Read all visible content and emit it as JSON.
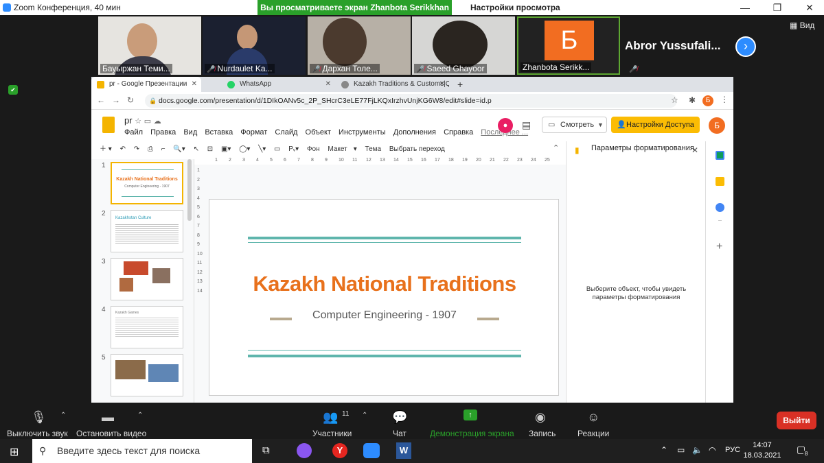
{
  "zoom": {
    "title": "Zoom Конференция, 40 мин",
    "banner": "Вы просматриваете экран Zhanbota Serikkhan",
    "view_options": "Настройки просмотра",
    "view_label": "Вид",
    "participants": [
      {
        "name": "Бауыржан Теми...",
        "muted": false
      },
      {
        "name": "Nurdaulet Ka...",
        "muted": true
      },
      {
        "name": "Дархан Толе...",
        "muted": true
      },
      {
        "name": "Saeed Ghayoor",
        "muted": true
      },
      {
        "name": "Zhanbota Serikk...",
        "muted": false,
        "avatar_letter": "Б",
        "avatar_color": "#f26d21"
      },
      {
        "name": "Abror Yussufali...",
        "muted": true
      }
    ],
    "controls": {
      "mute": "Выключить звук",
      "video": "Остановить видео",
      "participants": "Участники",
      "participants_count": "11",
      "chat": "Чат",
      "share": "Демонстрация экрана",
      "record": "Запись",
      "reactions": "Реакции",
      "leave": "Выйти"
    }
  },
  "browser": {
    "tabs": [
      {
        "label": "pr - Google Презентации",
        "icon_color": "#f4b400"
      },
      {
        "label": "WhatsApp",
        "icon_color": "#25d366"
      },
      {
        "label": "Kazakh Traditions & Customs|Qaz",
        "icon_color": "#888888"
      }
    ],
    "url": "docs.google.com/presentation/d/1DIkOANv5c_2P_SHcrC3eLE77FjLKQxIrzhvUnjKG6W8/edit#slide=id.p",
    "profile_letter": "Б"
  },
  "slides_app": {
    "doc_title": "pr",
    "menu": [
      "Файл",
      "Правка",
      "Вид",
      "Вставка",
      "Формат",
      "Слайд",
      "Объект",
      "Инструменты",
      "Дополнения",
      "Справка"
    ],
    "last_edit": "Последнее ...",
    "present_label": "Смотреть",
    "access_label": "Настройки Доступа",
    "toolbar": {
      "background": "Фон",
      "layout": "Макет",
      "theme": "Тема",
      "transition": "Выбрать переход"
    },
    "ruler_ticks": [
      "1",
      "2",
      "3",
      "4",
      "5",
      "6",
      "7",
      "8",
      "9",
      "10",
      "11",
      "12",
      "13",
      "14",
      "15",
      "16",
      "17",
      "18",
      "19",
      "20",
      "21",
      "22",
      "23",
      "24",
      "25"
    ],
    "slide_numbers": [
      "1",
      "2",
      "3",
      "4",
      "5"
    ],
    "thumb_title_1": "Kazakh National Traditions",
    "thumb_subtitle_1": "Computer Engineering - 1907",
    "thumb_title_2": "Kazakhstan Culture",
    "thumb_title_4": "Kazakh Games",
    "slide": {
      "title": "Kazakh National Traditions",
      "subtitle": "Computer Engineering  - 1907",
      "accent_color": "#e8711c",
      "line_color": "#5eb5ac"
    },
    "format_panel": {
      "title": "Параметры форматирования",
      "message": "Выберите объект, чтобы увидеть параметры форматирования"
    }
  },
  "taskbar": {
    "search_placeholder": "Введите здесь текст для поиска",
    "lang": "РУС",
    "time": "14:07",
    "date": "18.03.2021",
    "notifications": "8"
  }
}
